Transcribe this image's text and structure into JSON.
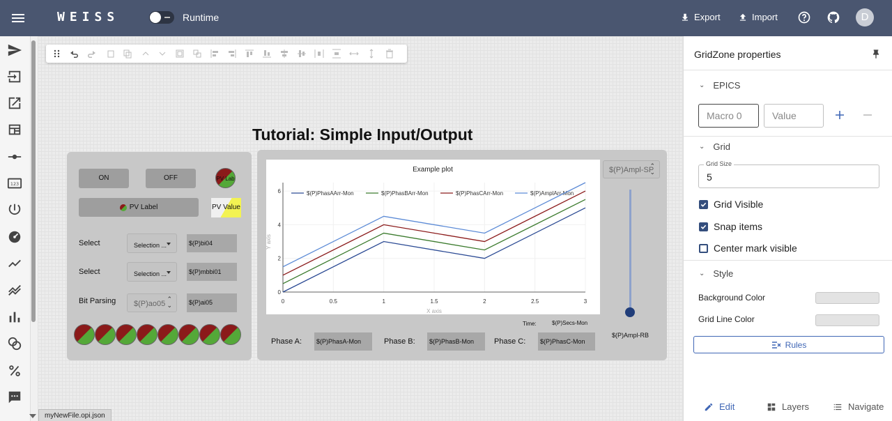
{
  "app": {
    "logo": "WEISS",
    "runtime_label": "Runtime",
    "export_label": "Export",
    "import_label": "Import",
    "avatar_initial": "D",
    "colors": {
      "topbar": "#4a5670",
      "accent": "#3f66b5"
    }
  },
  "canvas": {
    "title": "Tutorial: Simple Input/Output",
    "file_tab": "myNewFile.opi.json",
    "left_panel": {
      "on_label": "ON",
      "off_label": "OFF",
      "pv_lab": "PV Lab",
      "pv_label_btn": "PV Label",
      "pv_value": "PV Value",
      "rows": [
        {
          "label": "Select",
          "selection": "Selection ...",
          "pv": "$(P)bi04"
        },
        {
          "label": "Select",
          "selection": "Selection ...",
          "pv": "$(P)mbbi01"
        },
        {
          "label": "Bit Parsing",
          "selection": "$(P)ao05",
          "pv": "$(P)ai05"
        }
      ]
    },
    "right_panel": {
      "slider_top": "$(P)Ampl-SP",
      "slider_bottom": "$(P)Ampl-RB",
      "time_label": "Time:",
      "time_pv": "$(P)Secs-Mon",
      "phases": [
        {
          "label": "Phase A:",
          "pv": "$(P)PhasA-Mon"
        },
        {
          "label": "Phase B:",
          "pv": "$(P)PhasB-Mon"
        },
        {
          "label": "Phase C:",
          "pv": "$(P)PhasC-Mon"
        }
      ]
    }
  },
  "chart_data": {
    "type": "line",
    "title": "Example plot",
    "xlabel": "X axis",
    "ylabel": "Y axis",
    "x": [
      0,
      1,
      2,
      3
    ],
    "xlim": [
      0,
      3
    ],
    "ylim": [
      0,
      6.5
    ],
    "xticks": [
      "0",
      "0.5",
      "1",
      "1.5",
      "2",
      "2.5",
      "3"
    ],
    "yticks": [
      "0",
      "2",
      "4",
      "6"
    ],
    "legend": "top",
    "grid": true,
    "series": [
      {
        "name": "$(P)PhasAArr-Mon",
        "color": "#2b4a94",
        "values": [
          0,
          3,
          2,
          5
        ]
      },
      {
        "name": "$(P)PhasBArr-Mon",
        "color": "#3a7a2c",
        "values": [
          0.5,
          3.5,
          2.5,
          5.5
        ]
      },
      {
        "name": "$(P)PhasCArr-Mon",
        "color": "#8b1a1a",
        "values": [
          1,
          4,
          3,
          6
        ]
      },
      {
        "name": "$(P)AmplArr-Mon",
        "color": "#5b8ad6",
        "values": [
          1.5,
          4.5,
          3.5,
          6.5
        ]
      }
    ]
  },
  "properties": {
    "header": "GridZone properties",
    "epics_label": "EPICS",
    "macro_placeholder": "Macro 0",
    "value_placeholder": "Value",
    "grid_label": "Grid",
    "grid_size_label": "Grid Size",
    "grid_size_value": "5",
    "checks": [
      {
        "label": "Grid Visible",
        "checked": true
      },
      {
        "label": "Snap items",
        "checked": true
      },
      {
        "label": "Center mark visible",
        "checked": false
      }
    ],
    "style_label": "Style",
    "background_color_label": "Background Color",
    "grid_line_color_label": "Grid Line Color",
    "rules_label": "Rules",
    "tabs": [
      "Edit",
      "Layers",
      "Navigate"
    ]
  }
}
